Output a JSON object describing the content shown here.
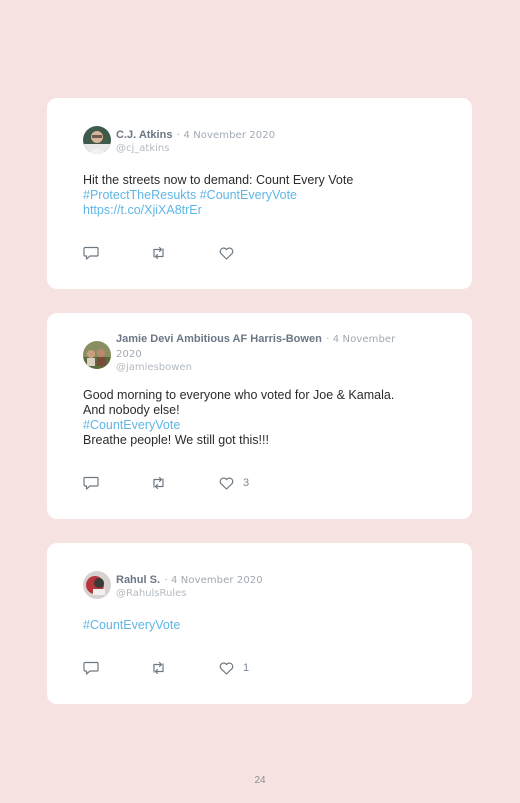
{
  "tweets": [
    {
      "name": "C.J. Atkins",
      "date": "· 4 November 2020",
      "handle": "@cj_atkins",
      "lines": [
        {
          "text": "Hit the streets now to demand: Count Every Vote",
          "kind": "text"
        },
        {
          "text": "#ProtectTheResukts #CountEveryVote",
          "kind": "tag"
        },
        {
          "text": "https://t.co/XjiXA8trEr",
          "kind": "tag"
        }
      ],
      "likes": ""
    },
    {
      "name": "Jamie Devi Ambitious AF Harris-Bowen",
      "date": "· 4 November 2020",
      "handle": "@jamiesbowen",
      "lines": [
        {
          "text": "Good morning to everyone who voted for Joe & Kamala.",
          "kind": "text"
        },
        {
          "text": "And nobody else!",
          "kind": "text"
        },
        {
          "text": "#CountEveryVote",
          "kind": "tag"
        },
        {
          "text": "Breathe people! We still got this!!!",
          "kind": "text"
        }
      ],
      "likes": "3"
    },
    {
      "name": "Rahul S.",
      "date": "· 4 November 2020",
      "handle": "@RahulsRules",
      "lines": [
        {
          "text": "#CountEveryVote",
          "kind": "tag"
        }
      ],
      "likes": "1"
    }
  ],
  "icons": {
    "reply": "reply-icon",
    "retweet": "retweet-icon",
    "like": "heart-icon"
  },
  "colors": {
    "background": "#f7e2e2",
    "card": "#ffffff",
    "hashtag": "#5fb6e6",
    "name": "#6b7785"
  },
  "page_number": "24"
}
